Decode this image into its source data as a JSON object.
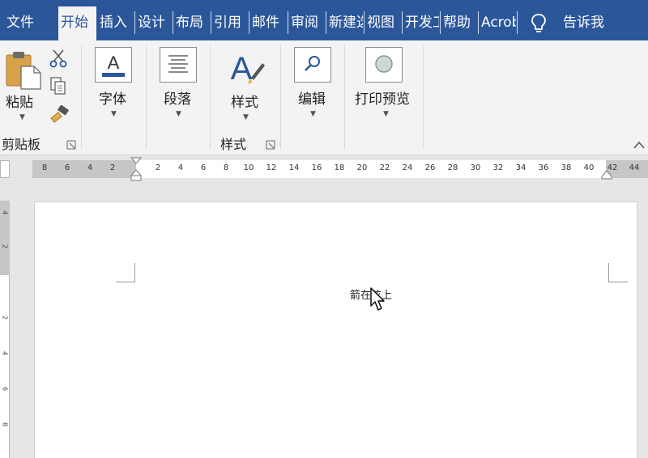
{
  "tabs": [
    {
      "label": "文件",
      "active": false
    },
    {
      "label": "开始",
      "active": true
    },
    {
      "label": "插入",
      "active": false
    },
    {
      "label": "设计",
      "active": false
    },
    {
      "label": "布局",
      "active": false
    },
    {
      "label": "引用",
      "active": false
    },
    {
      "label": "邮件",
      "active": false
    },
    {
      "label": "审阅",
      "active": false
    },
    {
      "label": "新建选项卡",
      "active": false
    },
    {
      "label": "视图",
      "active": false
    },
    {
      "label": "开发工具",
      "active": false
    },
    {
      "label": "帮助",
      "active": false
    },
    {
      "label": "Acrobat",
      "active": false
    }
  ],
  "tell_me": {
    "label": "告诉我",
    "icon": "lightbulb-icon"
  },
  "ribbon": {
    "clipboard": {
      "paste_label": "粘贴",
      "group_label": "剪贴板"
    },
    "font": {
      "label": "字体"
    },
    "paragraph": {
      "label": "段落"
    },
    "styles": {
      "label": "样式",
      "group_label": "样式"
    },
    "editing": {
      "label": "编辑"
    },
    "print_preview": {
      "label": "打印预览"
    }
  },
  "ruler": {
    "ticks": [
      "8",
      "6",
      "4",
      "2",
      "2",
      "4",
      "6",
      "8",
      "10",
      "12",
      "14",
      "16",
      "18",
      "20",
      "22",
      "24",
      "26",
      "28",
      "30",
      "32",
      "34",
      "36",
      "38",
      "40",
      "42",
      "44"
    ]
  },
  "vruler": {
    "ticks": [
      "4",
      "2",
      "2",
      "4",
      "6",
      "8"
    ]
  },
  "document": {
    "text": "箭在弦上"
  },
  "colors": {
    "accent": "#2b579a",
    "ribbon_bg": "#f3f3f3",
    "workspace": "#e6e6e6"
  }
}
